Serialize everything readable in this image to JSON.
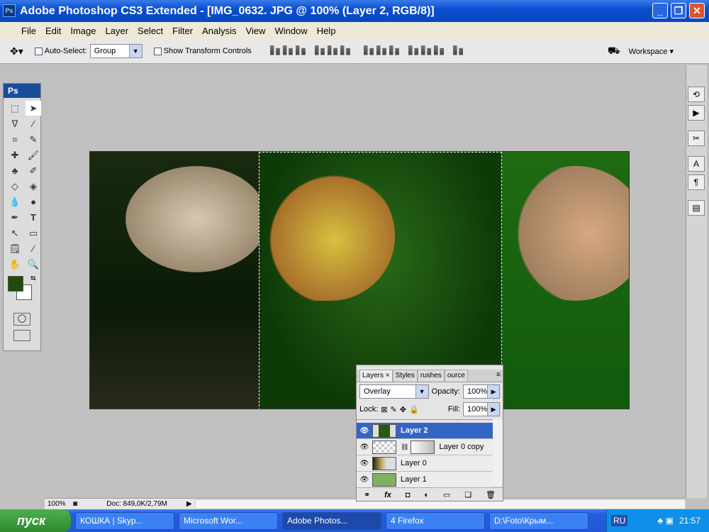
{
  "window": {
    "title": "Adobe Photoshop CS3 Extended - [IMG_0632. JPG @ 100% (Layer 2, RGB/8)]",
    "app_icon": "Ps"
  },
  "menu": [
    "File",
    "Edit",
    "Image",
    "Layer",
    "Select",
    "Filter",
    "Analysis",
    "View",
    "Window",
    "Help"
  ],
  "options": {
    "auto_select": "Auto-Select:",
    "auto_select_value": "Group",
    "show_transform": "Show Transform Controls",
    "workspace": "Workspace ▾"
  },
  "tools": {
    "header": "Ps",
    "foreground_color": "#234a0c",
    "background_color": "#ffffff",
    "icons": [
      "marquee",
      "move",
      "lasso",
      "magic-wand",
      "crop",
      "slice",
      "healing",
      "brush",
      "stamp",
      "history-brush",
      "eraser",
      "bucket",
      "blur",
      "dodge",
      "pen",
      "type",
      "path-select",
      "shape",
      "notes",
      "eyedropper",
      "hand",
      "zoom"
    ]
  },
  "layers_panel": {
    "tabs": [
      "Layers ×",
      "Styles",
      "rushes",
      "ource"
    ],
    "blend_mode": "Overlay",
    "opacity_label": "Opacity:",
    "opacity": "100%",
    "lock_label": "Lock:",
    "fill_label": "Fill:",
    "fill": "100%",
    "layers": [
      {
        "name": "Layer 2",
        "selected": true
      },
      {
        "name": "Layer 0 copy",
        "selected": false
      },
      {
        "name": "Layer 0",
        "selected": false
      },
      {
        "name": "Layer 1",
        "selected": false
      }
    ]
  },
  "status": {
    "zoom": "100%",
    "doc": "Doc: 849,0K/2,79M"
  },
  "taskbar": {
    "start": "пуск",
    "tasks": [
      "КОШКА | Skyp...",
      "Microsoft Wor...",
      "Adobe Photos...",
      "4 Firefox",
      "D:\\Foto\\Крым..."
    ],
    "active_task": 2,
    "lang": "RU",
    "time": "21:57"
  }
}
